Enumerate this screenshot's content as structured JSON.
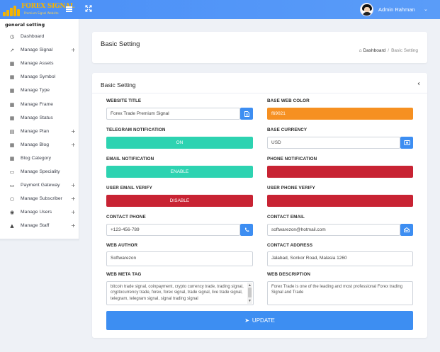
{
  "brand": {
    "title": "FOREX SIGNAL",
    "subtitle": "Premium Signal Website"
  },
  "user": {
    "name": "Admin Rahman"
  },
  "sidebar": {
    "heading": "general setting",
    "items": [
      {
        "label": "Dashboard",
        "icon": "gauge-icon",
        "expandable": false
      },
      {
        "label": "Manage Signal",
        "icon": "chart-line-icon",
        "expandable": true
      },
      {
        "label": "Manage Assets",
        "icon": "grid-icon",
        "expandable": false
      },
      {
        "label": "Manage Symbol",
        "icon": "grid-icon",
        "expandable": false
      },
      {
        "label": "Manage Type",
        "icon": "grid-icon",
        "expandable": false
      },
      {
        "label": "Manage Frame",
        "icon": "grid-icon",
        "expandable": false
      },
      {
        "label": "Manage Status",
        "icon": "grid-icon",
        "expandable": false
      },
      {
        "label": "Manage Plan",
        "icon": "columns-icon",
        "expandable": true
      },
      {
        "label": "Manage Blog",
        "icon": "grid-icon",
        "expandable": true
      },
      {
        "label": "Blog Category",
        "icon": "grid-icon",
        "expandable": false
      },
      {
        "label": "Manage Speciality",
        "icon": "cube-icon",
        "expandable": false
      },
      {
        "label": "Payment Gateway",
        "icon": "credit-card-icon",
        "expandable": true
      },
      {
        "label": "Manage Subscriber",
        "icon": "chat-icon",
        "expandable": true
      },
      {
        "label": "Manage Users",
        "icon": "users-icon",
        "expandable": true
      },
      {
        "label": "Manage Staff",
        "icon": "user-secret-icon",
        "expandable": true
      }
    ]
  },
  "header": {
    "title": "Basic Setting",
    "breadcrumb": {
      "home": "Dashboard",
      "separator": "/",
      "current": "Basic Setting"
    }
  },
  "form": {
    "title": "Basic Setting",
    "website_title": {
      "label": "WEBSITE TITLE",
      "value": "Forex Trade Premium Signal"
    },
    "base_web_color": {
      "label": "BASE WEB COLOR",
      "value": "f69021",
      "color": "#f69021"
    },
    "telegram_notification": {
      "label": "TELEGRAM NOTIFICATION",
      "value": "ON",
      "color": "#2dd3b1"
    },
    "base_currency": {
      "label": "BASE CURRENCY",
      "value": "USD"
    },
    "email_notification": {
      "label": "EMAIL NOTIFICATION",
      "value": "ENABLE",
      "color": "#2dd3b1"
    },
    "phone_notification": {
      "label": "PHONE NOTIFICATION",
      "value": "",
      "color": "#c82333"
    },
    "user_email_verify": {
      "label": "USER EMAIL VERIFY",
      "value": "DISABLE",
      "color": "#c82333"
    },
    "user_phone_verify": {
      "label": "USER PHONE VERIFY",
      "value": "",
      "color": "#c82333"
    },
    "contact_phone": {
      "label": "CONTACT PHONE",
      "value": "+123-456-789"
    },
    "contact_email": {
      "label": "CONTACT EMAIL",
      "value": "softwarezon@hotmail.com"
    },
    "web_author": {
      "label": "WEB AUTHOR",
      "value": "Softwarezon"
    },
    "contact_address": {
      "label": "CONTACT ADDRESS",
      "value": "Jalabad, Sonkor Road, Malasia 1260"
    },
    "web_meta_tag": {
      "label": "WEB META TAG",
      "value": "bitcoin trade signal, coinpayment, crypto currency trade, trading signal, cryptocurrency trade, forex, forex signal, trade signal, live trade signal, telegram, telegram signal, signal trading signal"
    },
    "web_description": {
      "label": "WEB DESCRIPTION",
      "value": "Forex Trade is one of the leading and most professional Forex trading Signal and Trade"
    },
    "update_label": "UPDATE"
  },
  "colors": {
    "accent": "#3d8ef2",
    "teal": "#2dd3b1",
    "red": "#c82333",
    "orange": "#f69021"
  }
}
